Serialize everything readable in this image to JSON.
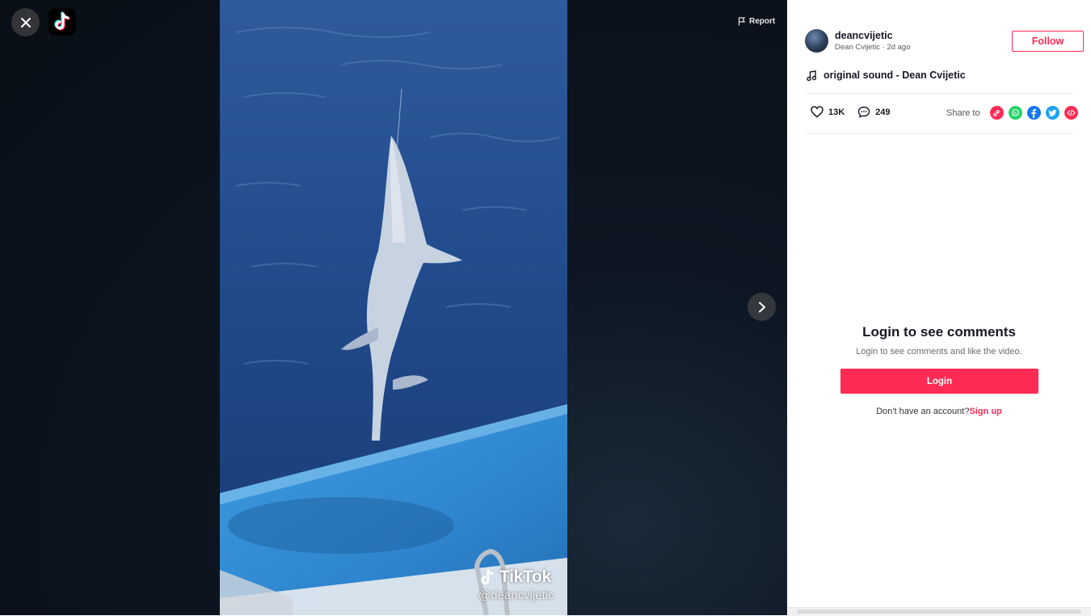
{
  "header": {
    "report_label": "Report"
  },
  "video": {
    "watermark_brand": "TikTok",
    "watermark_handle": "@deancvijetic"
  },
  "panel": {
    "username": "deancvijetic",
    "display_name": "Dean Cvijetic",
    "time_ago": "2d ago",
    "follow_label": "Follow",
    "sound_title": "original sound - Dean Cvijetic",
    "likes": "13K",
    "comments": "249",
    "share_label": "Share to",
    "share_targets": [
      "link-icon",
      "whatsapp-icon",
      "facebook-icon",
      "twitter-icon",
      "embed-icon"
    ],
    "login_title": "Login to see comments",
    "login_subtitle": "Login to see comments and like the video.",
    "login_button": "Login",
    "signup_prompt": "Don't have an account?",
    "signup_link": "Sign up"
  },
  "colors": {
    "accent": "#fe2c55",
    "whatsapp": "#25d366",
    "facebook": "#1877f2",
    "twitter": "#1da1f2"
  }
}
